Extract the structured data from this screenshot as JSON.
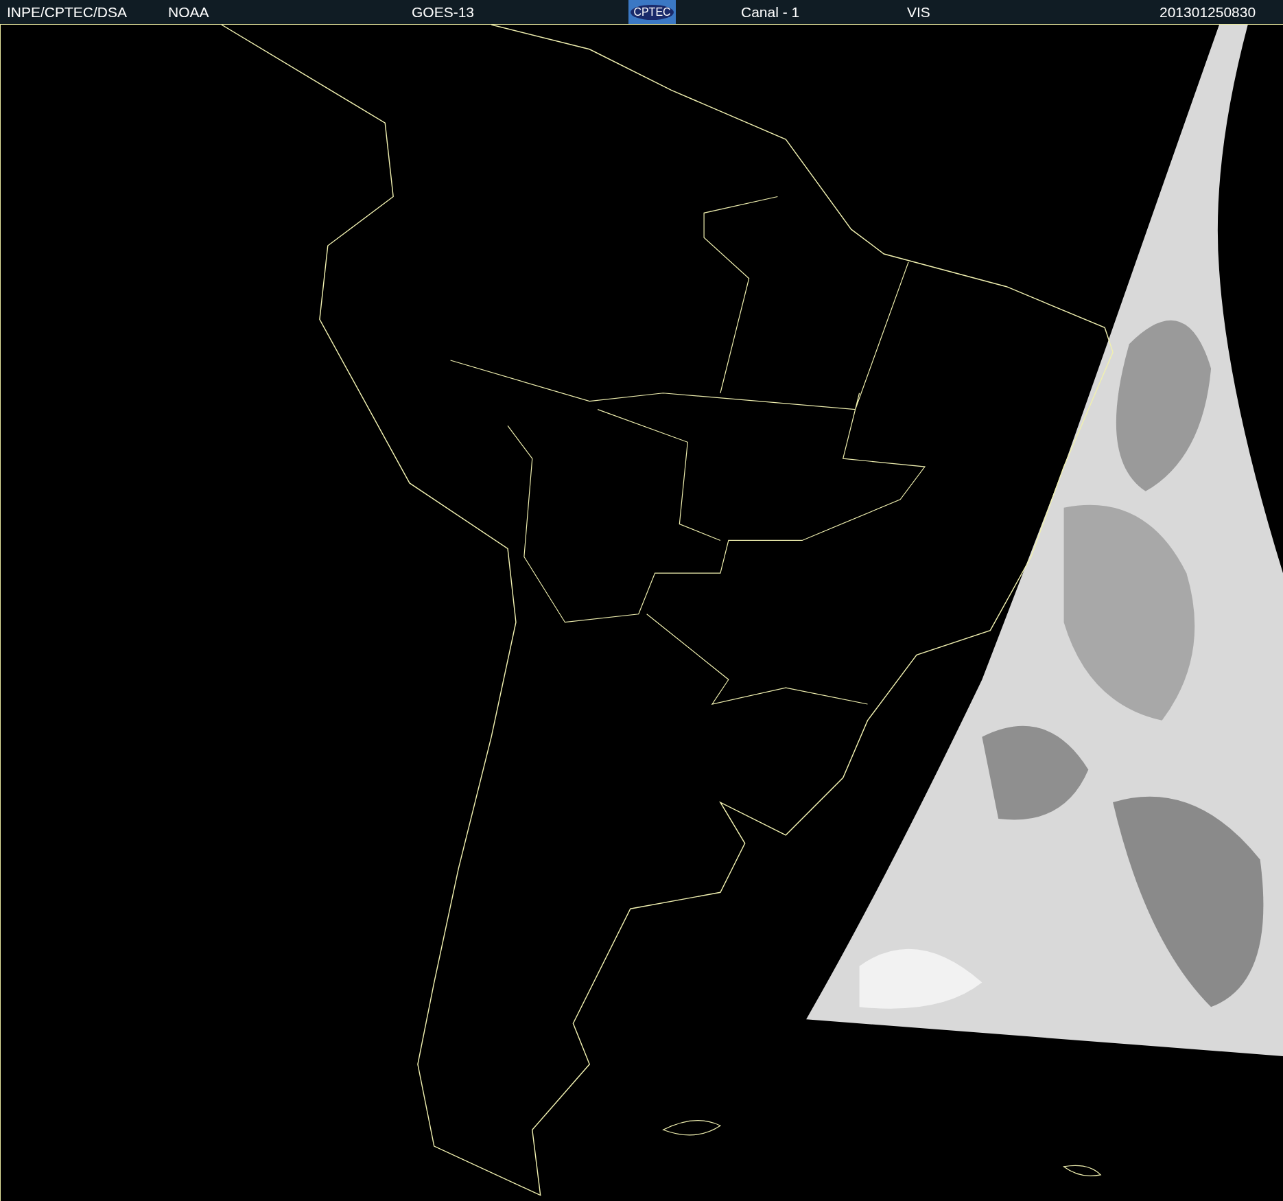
{
  "header": {
    "source": "INPE/CPTEC/DSA",
    "agency": "NOAA",
    "satellite": "GOES-13",
    "logo_text": "CPTEC",
    "channel": "Canal - 1",
    "band": "VIS",
    "timestamp": "201301250830"
  }
}
